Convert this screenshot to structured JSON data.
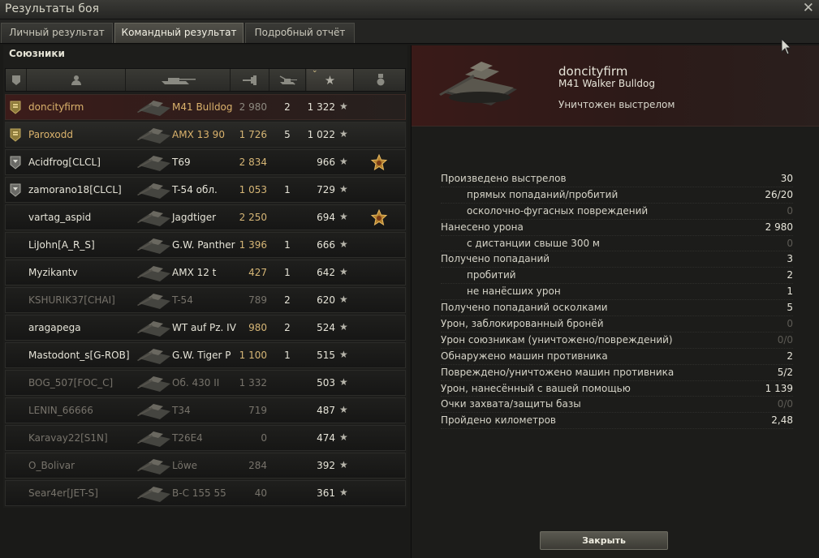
{
  "window": {
    "title": "Результаты боя"
  },
  "tabs": [
    "Личный результат",
    "Командный результат",
    "Подробный отчёт"
  ],
  "allies": {
    "label": "Союзники",
    "rows": [
      {
        "name": "doncityfirm",
        "tank": "M41 Bulldog",
        "damage": "2 980",
        "kills": "2",
        "xp": "1 322",
        "kind": "self",
        "badge": "rank",
        "medal": ""
      },
      {
        "name": "Paroxodd",
        "tank": "AMX 13 90",
        "damage": "1 726",
        "kills": "5",
        "xp": "1 022",
        "kind": "platoon",
        "badge": "rank",
        "medal": ""
      },
      {
        "name": "Acidfrog[CLCL]",
        "tank": "T69",
        "damage": "2 834",
        "kills": "",
        "xp": "966",
        "kind": "alive",
        "badge": "rank2",
        "medal": "medal"
      },
      {
        "name": "zamorano18[CLCL]",
        "tank": "T-54 обл.",
        "damage": "1 053",
        "kills": "1",
        "xp": "729",
        "kind": "alive",
        "badge": "rank2",
        "medal": ""
      },
      {
        "name": "vartag_aspid",
        "tank": "Jagdtiger",
        "damage": "2 250",
        "kills": "",
        "xp": "694",
        "kind": "alive",
        "badge": "",
        "medal": "medal"
      },
      {
        "name": "LiJohn[A_R_S]",
        "tank": "G.W. Panther",
        "damage": "1 396",
        "kills": "1",
        "xp": "666",
        "kind": "alive",
        "badge": "",
        "medal": ""
      },
      {
        "name": "Myzikantv",
        "tank": "AMX 12 t",
        "damage": "427",
        "kills": "1",
        "xp": "642",
        "kind": "alive",
        "badge": "",
        "medal": ""
      },
      {
        "name": "KSHURIK37[CHAI]",
        "tank": "T-54",
        "damage": "789",
        "kills": "2",
        "xp": "620",
        "kind": "dead",
        "badge": "",
        "medal": ""
      },
      {
        "name": "aragapega",
        "tank": "WT auf Pz. IV",
        "damage": "980",
        "kills": "2",
        "xp": "524",
        "kind": "alive",
        "badge": "",
        "medal": ""
      },
      {
        "name": "Mastodont_s[G-ROB]",
        "tank": "G.W. Tiger P",
        "damage": "1 100",
        "kills": "1",
        "xp": "515",
        "kind": "alive",
        "badge": "",
        "medal": ""
      },
      {
        "name": "BOG_507[FOC_C]",
        "tank": "Об. 430 II",
        "damage": "1 332",
        "kills": "",
        "xp": "503",
        "kind": "dead",
        "badge": "",
        "medal": ""
      },
      {
        "name": "LENIN_66666",
        "tank": "T34",
        "damage": "719",
        "kills": "",
        "xp": "487",
        "kind": "dead",
        "badge": "",
        "medal": ""
      },
      {
        "name": "Karavay22[S1N]",
        "tank": "T26E4",
        "damage": "0",
        "kills": "",
        "xp": "474",
        "kind": "dead",
        "badge": "",
        "medal": ""
      },
      {
        "name": "O_Bolivar",
        "tank": "Löwe",
        "damage": "284",
        "kills": "",
        "xp": "392",
        "kind": "dead",
        "badge": "",
        "medal": ""
      },
      {
        "name": "Sear4er[JET-S]",
        "tank": "B-C 155 55",
        "damage": "40",
        "kills": "",
        "xp": "361",
        "kind": "dead",
        "badge": "",
        "medal": ""
      }
    ]
  },
  "detail": {
    "player": "doncityfirm",
    "vehicle": "M41 Walker Bulldog",
    "status": "Уничтожен выстрелом",
    "stats": [
      {
        "label": "Произведено выстрелов",
        "value": "30",
        "sub": false,
        "zero": false
      },
      {
        "label": "прямых попаданий/пробитий",
        "value": "26/20",
        "sub": true,
        "zero": false
      },
      {
        "label": "осколочно-фугасных повреждений",
        "value": "0",
        "sub": true,
        "zero": true
      },
      {
        "label": "Нанесено урона",
        "value": "2 980",
        "sub": false,
        "zero": false
      },
      {
        "label": "с дистанции свыше 300 м",
        "value": "0",
        "sub": true,
        "zero": true
      },
      {
        "label": "Получено попаданий",
        "value": "3",
        "sub": false,
        "zero": false
      },
      {
        "label": "пробитий",
        "value": "2",
        "sub": true,
        "zero": false
      },
      {
        "label": "не нанёсших урон",
        "value": "1",
        "sub": true,
        "zero": false
      },
      {
        "label": "Получено попаданий осколками",
        "value": "5",
        "sub": false,
        "zero": false
      },
      {
        "label": "Урон, заблокированный бронёй",
        "value": "0",
        "sub": false,
        "zero": true
      },
      {
        "label": "Урон союзникам (уничтожено/повреждений)",
        "value": "0/0",
        "sub": false,
        "zero": true
      },
      {
        "label": "Обнаружено машин противника",
        "value": "2",
        "sub": false,
        "zero": false
      },
      {
        "label": "Повреждено/уничтожено машин противника",
        "value": "5/2",
        "sub": false,
        "zero": false
      },
      {
        "label": "Урон, нанесённый с вашей помощью",
        "value": "1 139",
        "sub": false,
        "zero": false
      },
      {
        "label": "Очки захвата/защиты базы",
        "value": "0/0",
        "sub": false,
        "zero": true
      },
      {
        "label": "Пройдено километров",
        "value": "2,48",
        "sub": false,
        "zero": false
      }
    ],
    "close_label": "Закрыть"
  },
  "colors": {
    "accent_gold": "#dab26c",
    "self_row": "#3c1c1a"
  }
}
